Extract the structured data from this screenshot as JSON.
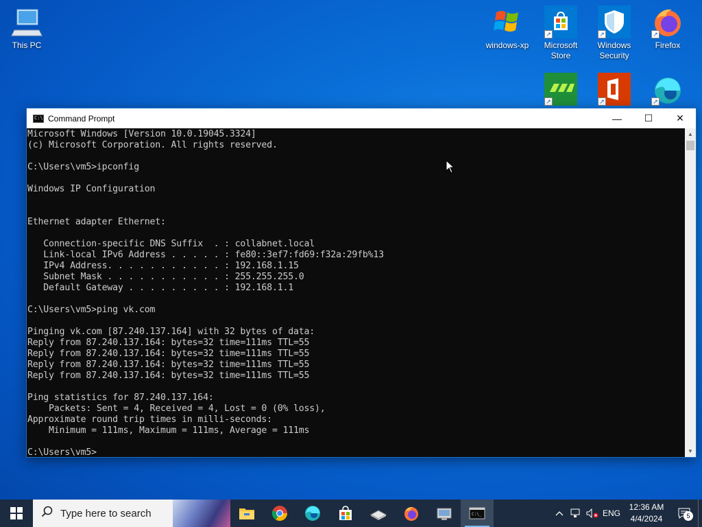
{
  "desktop": {
    "icons": [
      {
        "label": "This PC"
      },
      {
        "label": "windows-xp"
      },
      {
        "label": "Microsoft Store"
      },
      {
        "label": "Windows Security"
      },
      {
        "label": "Firefox"
      }
    ]
  },
  "window": {
    "title": "Command Prompt",
    "controls": {
      "minimize": "—",
      "maximize": "☐",
      "close": "✕"
    }
  },
  "console": {
    "lines": [
      "Microsoft Windows [Version 10.0.19045.3324]",
      "(c) Microsoft Corporation. All rights reserved.",
      "",
      "C:\\Users\\vm5>ipconfig",
      "",
      "Windows IP Configuration",
      "",
      "",
      "Ethernet adapter Ethernet:",
      "",
      "   Connection-specific DNS Suffix  . : collabnet.local",
      "   Link-local IPv6 Address . . . . . : fe80::3ef7:fd69:f32a:29fb%13",
      "   IPv4 Address. . . . . . . . . . . : 192.168.1.15",
      "   Subnet Mask . . . . . . . . . . . : 255.255.255.0",
      "   Default Gateway . . . . . . . . . : 192.168.1.1",
      "",
      "C:\\Users\\vm5>ping vk.com",
      "",
      "Pinging vk.com [87.240.137.164] with 32 bytes of data:",
      "Reply from 87.240.137.164: bytes=32 time=111ms TTL=55",
      "Reply from 87.240.137.164: bytes=32 time=111ms TTL=55",
      "Reply from 87.240.137.164: bytes=32 time=111ms TTL=55",
      "Reply from 87.240.137.164: bytes=32 time=111ms TTL=55",
      "",
      "Ping statistics for 87.240.137.164:",
      "    Packets: Sent = 4, Received = 4, Lost = 0 (0% loss),",
      "Approximate round trip times in milli-seconds:",
      "    Minimum = 111ms, Maximum = 111ms, Average = 111ms",
      "",
      "C:\\Users\\vm5>"
    ]
  },
  "taskbar": {
    "search_placeholder": "Type here to search",
    "tray": {
      "language": "ENG",
      "time": "12:36 AM",
      "date": "4/4/2024",
      "notification_count": "5"
    }
  },
  "colors": {
    "console_bg": "#0c0c0c",
    "console_fg": "#cccccc",
    "taskbar_bg": "#1c2b3f",
    "accent": "#76b9ed"
  }
}
